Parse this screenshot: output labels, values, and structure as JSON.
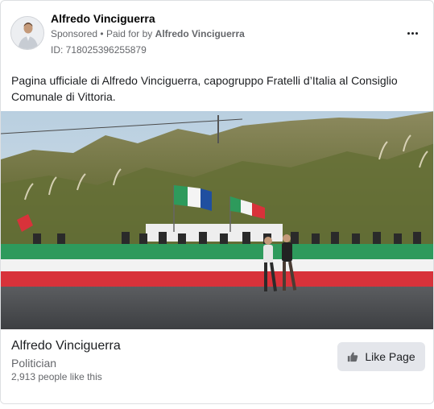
{
  "post": {
    "page_name": "Alfredo Vinciguerra",
    "sponsored_label": "Sponsored",
    "separator": "•",
    "paid_for_prefix": "Paid for by",
    "paid_for_name": "Alfredo Vinciguerra",
    "ad_id": "ID: 718025396255879",
    "body_text": "Pagina ufficiale di Alfredo Vinciguerra, capogruppo Fratelli d’Italia al Consiglio Comunale di Vittoria.",
    "more_options_icon": "more-horizontal-icon"
  },
  "footer": {
    "page_name": "Alfredo Vinciguerra",
    "category": "Politician",
    "likes_text": "2,913 people like this",
    "like_button_label": "Like Page",
    "like_icon": "thumbs-up-icon"
  },
  "colors": {
    "flag_green": "#2e9a5c",
    "flag_white": "#f2f2f2",
    "flag_red": "#d8323a",
    "button_bg": "#e4e6eb",
    "secondary_text": "#65676b"
  }
}
